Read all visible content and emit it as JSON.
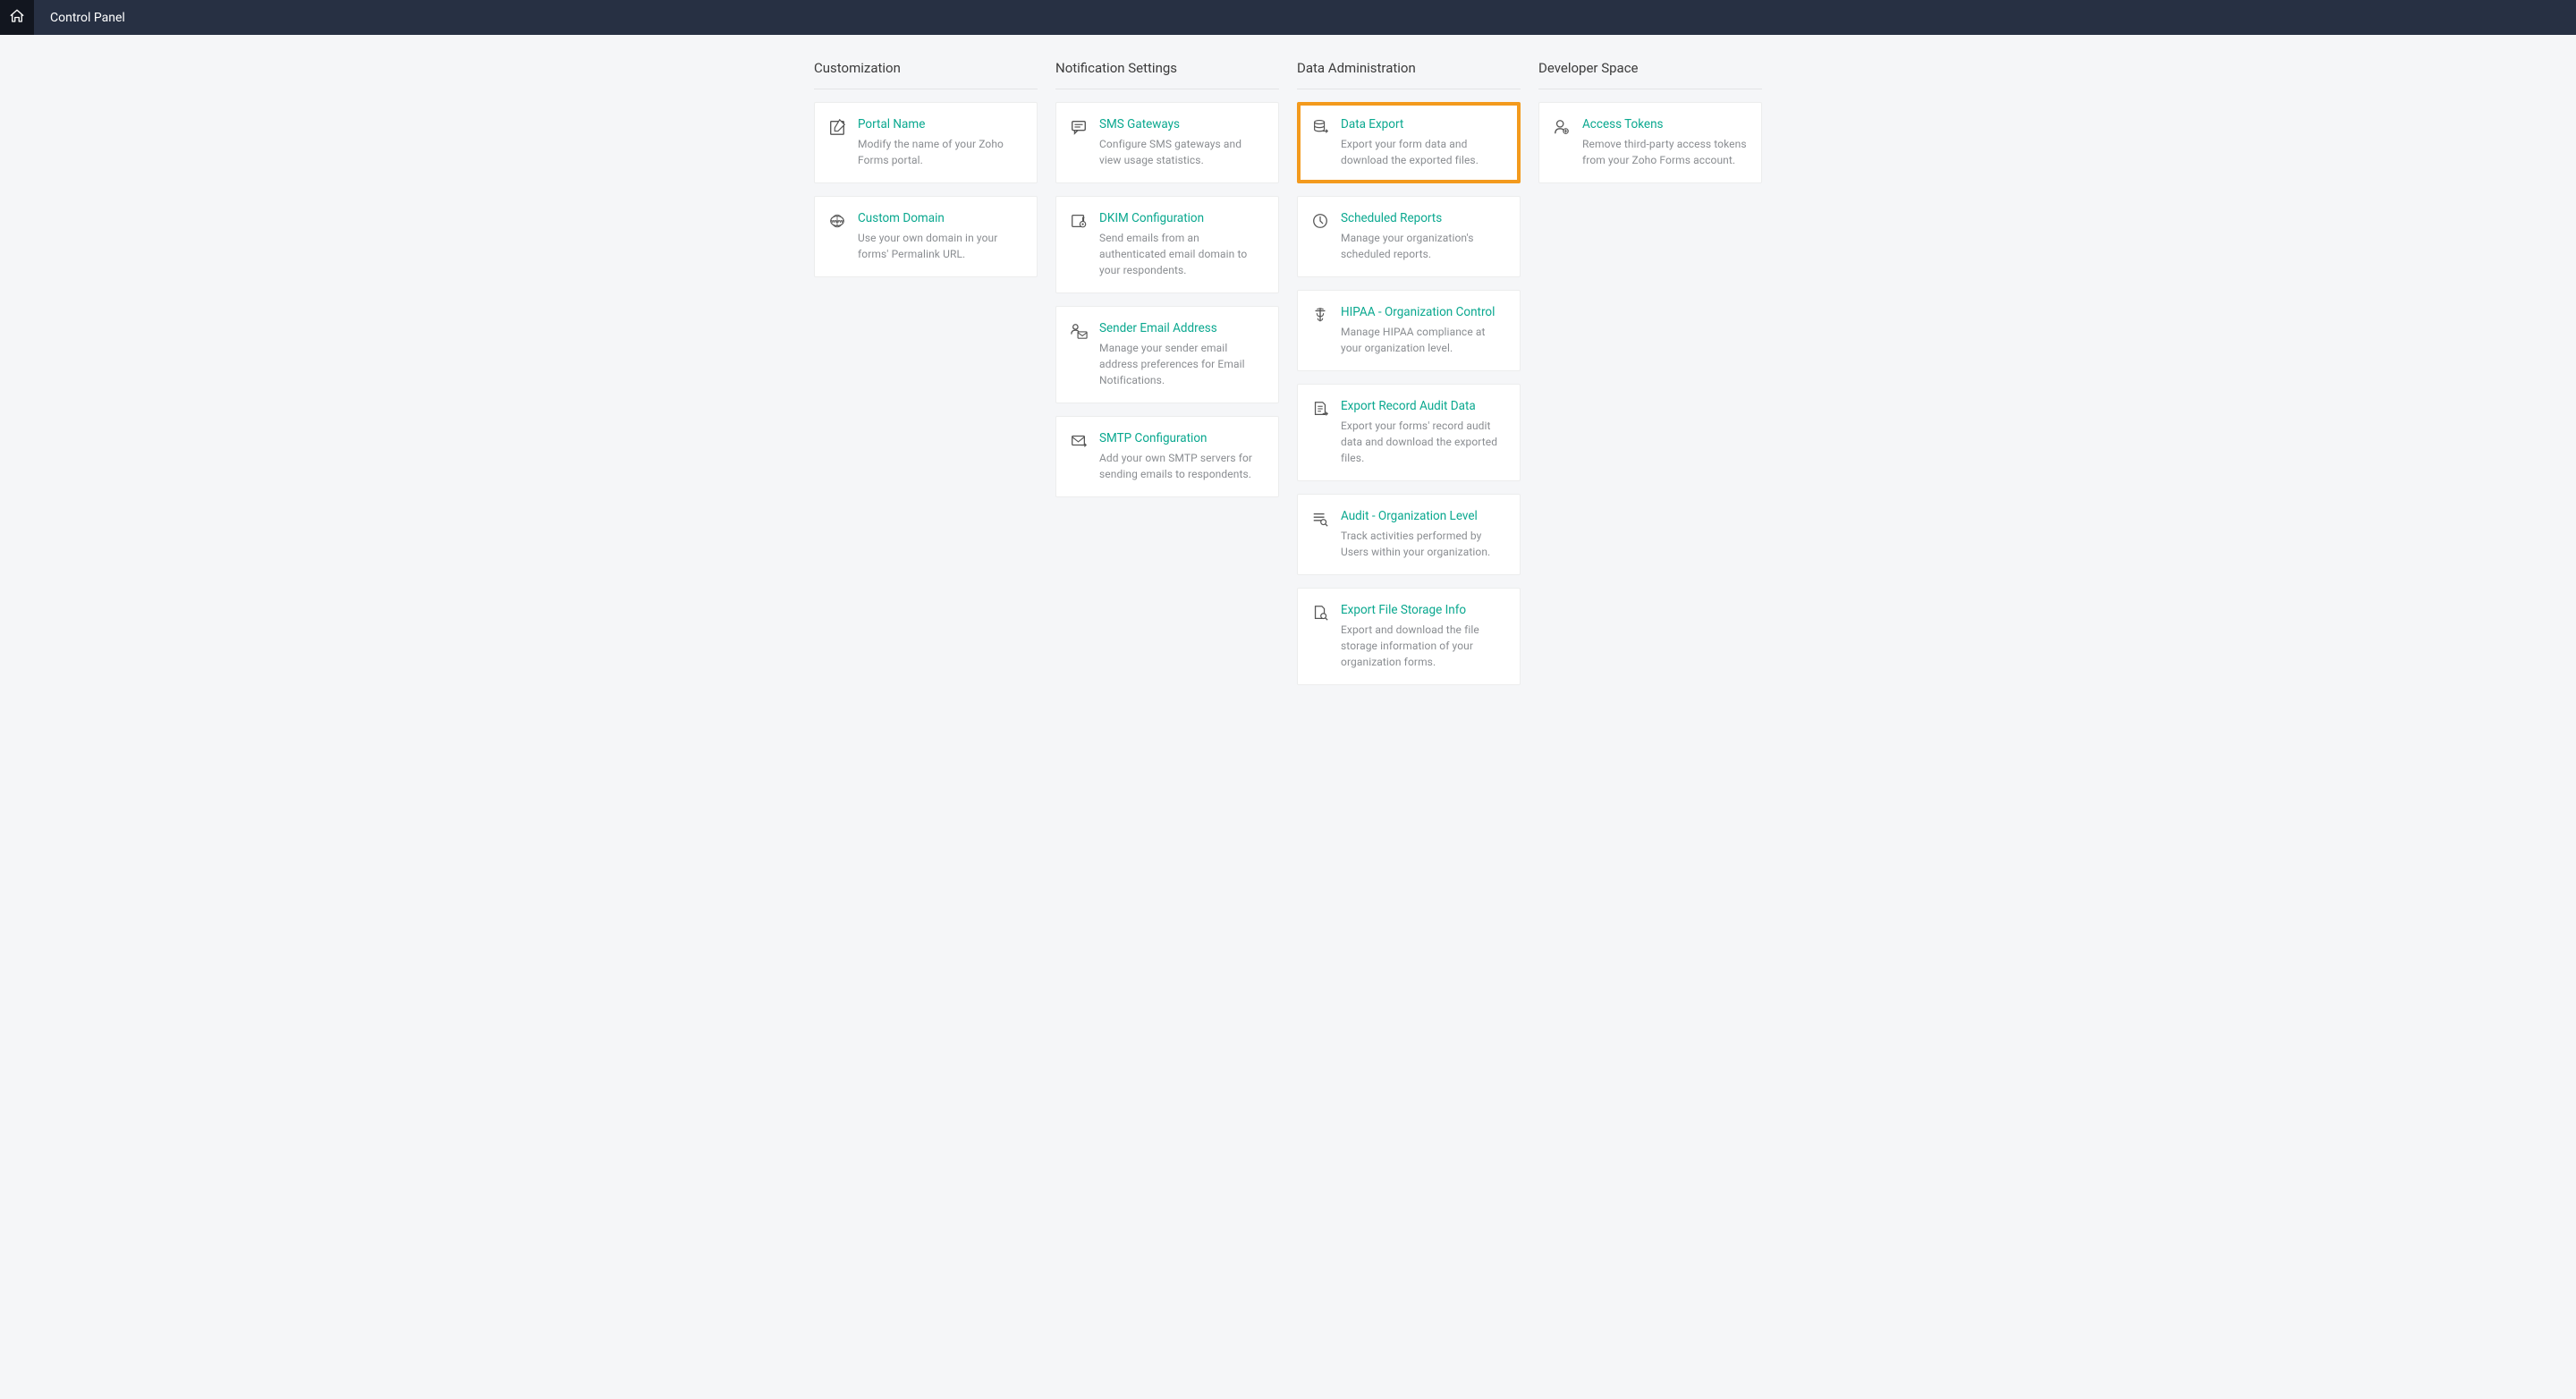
{
  "header": {
    "title": "Control Panel"
  },
  "columns": [
    {
      "heading": "Customization",
      "cards": [
        {
          "icon": "edit-square-icon",
          "title": "Portal Name",
          "desc": "Modify the name of your Zoho Forms portal.",
          "highlight": false
        },
        {
          "icon": "globe-www-icon",
          "title": "Custom Domain",
          "desc": "Use your own domain in your forms' Permalink URL.",
          "highlight": false
        }
      ]
    },
    {
      "heading": "Notification Settings",
      "cards": [
        {
          "icon": "chat-bubble-icon",
          "title": "SMS Gateways",
          "desc": "Configure SMS gateways and view usage statistics.",
          "highlight": false
        },
        {
          "icon": "key-icon",
          "title": "DKIM Configuration",
          "desc": "Send emails from an authenticated email domain to your respondents.",
          "highlight": false
        },
        {
          "icon": "user-mail-icon",
          "title": "Sender Email Address",
          "desc": "Manage your sender email address preferences for Email Notifications.",
          "highlight": false
        },
        {
          "icon": "mail-arrow-icon",
          "title": "SMTP Configuration",
          "desc": "Add your own SMTP servers for sending emails to respondents.",
          "highlight": false
        }
      ]
    },
    {
      "heading": "Data Administration",
      "cards": [
        {
          "icon": "database-export-icon",
          "title": "Data Export",
          "desc": "Export your form data and download the exported files.",
          "highlight": true
        },
        {
          "icon": "clock-icon",
          "title": "Scheduled Reports",
          "desc": "Manage your organization's scheduled reports.",
          "highlight": false
        },
        {
          "icon": "medical-icon",
          "title": "HIPAA - Organization Control",
          "desc": "Manage HIPAA compliance at your organization level.",
          "highlight": false
        },
        {
          "icon": "document-export-icon",
          "title": "Export Record Audit Data",
          "desc": "Export your forms' record audit data and download the exported files.",
          "highlight": false
        },
        {
          "icon": "list-search-icon",
          "title": "Audit - Organization Level",
          "desc": "Track activities performed by Users within your organization.",
          "highlight": false
        },
        {
          "icon": "file-search-icon",
          "title": "Export File Storage Info",
          "desc": "Export and download the file storage information of your organization forms.",
          "highlight": false
        }
      ]
    },
    {
      "heading": "Developer Space",
      "cards": [
        {
          "icon": "user-token-icon",
          "title": "Access Tokens",
          "desc": "Remove third-party access tokens from your Zoho Forms account.",
          "highlight": false
        }
      ]
    }
  ]
}
